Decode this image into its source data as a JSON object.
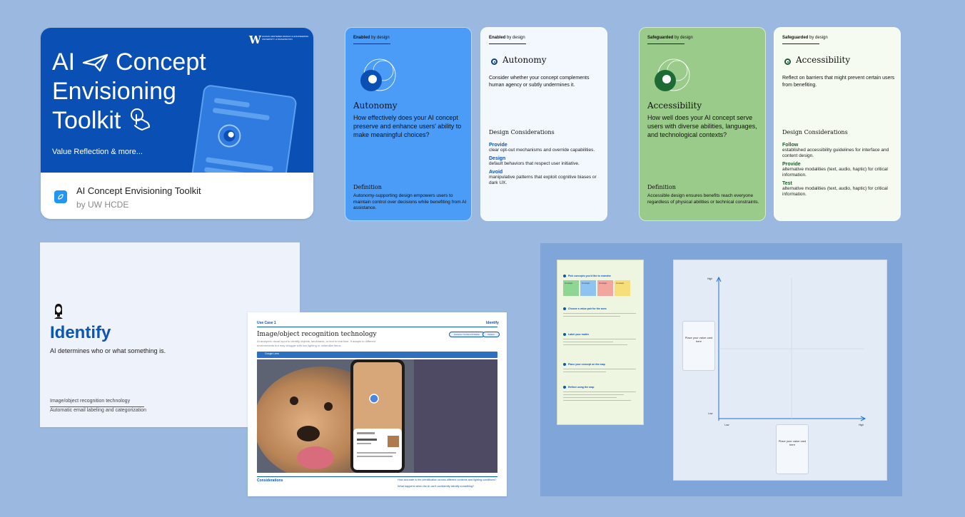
{
  "toolkit": {
    "title_line1": "AI",
    "title_line1b": "Concept",
    "title_line2": "Envisioning",
    "title_line3": "Toolkit",
    "subtitle": "Value Reflection & more...",
    "logo_letter": "W",
    "logo_text": "HUMAN CENTERED DESIGN & ENGINEERING UNIVERSITY of WASHINGTON",
    "name": "AI Concept Envisioning Toolkit",
    "by": "by UW HCDE",
    "cover_color": "#0a4fb3"
  },
  "cards": [
    {
      "kind": "front",
      "tag_bold": "Enabled",
      "tag_rest": " by design",
      "bg": "#4a9cf7",
      "name": "Autonomy",
      "question": "How effectively does your AI concept preserve and enhance users' ability to make meaningful choices?",
      "def_label": "Definition",
      "definition": "Autonomy-supporting design empowers users to maintain control over decisions while benefiting from AI assistance."
    },
    {
      "kind": "back",
      "tag_bold": "Enabled",
      "tag_rest": " by design",
      "bg": "#f3f7fe",
      "name": "Autonomy",
      "description": "Consider whether your concept complements human agency or subtly undermines it.",
      "dc_label": "Design Considerations",
      "items": [
        {
          "verb": "Provide",
          "text": "clear opt-out mechanisms and override capabilities."
        },
        {
          "verb": "Design",
          "text": "default behaviors that respect user initiative."
        },
        {
          "verb": "Avoid",
          "text": "manipulative patterns that exploit cognitive biases or dark UX."
        }
      ],
      "accent": "#0c56b3"
    },
    {
      "kind": "front",
      "tag_bold": "Safeguarded",
      "tag_rest": " by design",
      "bg": "#9bcb8a",
      "name": "Accessibility",
      "question": "How well does your AI concept serve users with diverse abilities, languages, and technological contexts?",
      "def_label": "Definition",
      "definition": "Accessible design ensures benefits reach everyone regardless of physical abilities or technical constraints."
    },
    {
      "kind": "back",
      "tag_bold": "Safeguarded",
      "tag_rest": " by design",
      "bg": "#f5fbf1",
      "name": "Accessibility",
      "description": "Reflect on barriers that might prevent certain users from benefiting.",
      "dc_label": "Design Considerations",
      "items": [
        {
          "verb": "Follow",
          "text": "established accessibility guidelines for interface and content design."
        },
        {
          "verb": "Provide",
          "text": "alternative modalities (text, audio, haptic) for critical information."
        },
        {
          "verb": "Test",
          "text": "alternative modalities (text, audio, haptic) for critical information."
        }
      ],
      "accent": "#1e5c2c"
    }
  ],
  "identify": {
    "title": "Identify",
    "description": "AI determines who or what something is.",
    "technology": "Image/object recognition technology",
    "use": "Automatic email labeling and categorization"
  },
  "usecase": {
    "label": "Use Case 1",
    "category": "Identify",
    "title": "Image/object recognition technology",
    "subtitle": "AI analyzes visual input to identify objects, landmarks, or text in real time. It adapts to different environments but may struggle with low lighting or unfamiliar items.",
    "chip1": "Camera / Content & Media",
    "chip2": "Visitors",
    "bar_label": "Google Lens",
    "considerations": "Considerations",
    "q1": "How accurate is the identification across different contexts and lighting conditions?",
    "q2": "What happens when the AI can't confidently identify something?"
  },
  "worksheet": {
    "step1": "Pick concepts you'd like to examine",
    "stickies": [
      {
        "label": "Concept",
        "color": "#8fd694"
      },
      {
        "label": "Concept",
        "color": "#8fc3f0"
      },
      {
        "label": "Concept",
        "color": "#f3a5a0"
      },
      {
        "label": "Concept",
        "color": "#f6df7a"
      }
    ],
    "step2": "Choose a value pair for the axes",
    "step3": "Label your matrix",
    "step4": "Place your concept on the map",
    "step5": "Reflect using the map"
  },
  "map": {
    "y_high": "High",
    "y_low": "Low",
    "x_low": "Low",
    "x_high": "High",
    "place_left": "Place your value card here",
    "place_bottom": "Place your value card here"
  }
}
